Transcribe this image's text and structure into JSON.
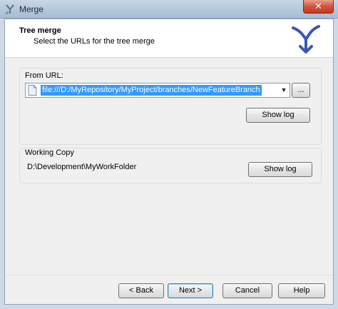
{
  "window": {
    "title": "Merge",
    "close_label": "✕"
  },
  "header": {
    "title": "Tree merge",
    "subtitle": "Select the URLs for the tree merge"
  },
  "from_url": {
    "label": "From URL:",
    "value": "file:///D:/MyRepository/MyProject/branches/NewFeatureBranch",
    "dropdown_glyph": "▼",
    "browse_label": "...",
    "show_log_label": "Show log"
  },
  "working_copy": {
    "label": "Working Copy",
    "path": "D:\\Development\\MyWorkFolder",
    "show_log_label": "Show log"
  },
  "footer": {
    "back_label": "< Back",
    "next_label": "Next >",
    "cancel_label": "Cancel",
    "help_label": "Help"
  }
}
